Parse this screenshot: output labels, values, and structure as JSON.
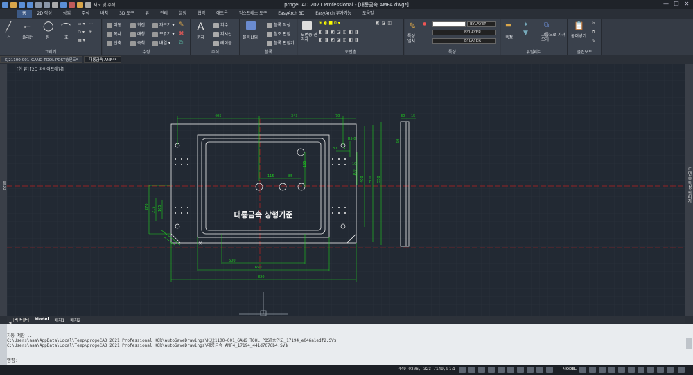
{
  "window": {
    "title": "progeCAD 2021 Professional - [대룡금속 AMF4.dwg*]",
    "quick_access_label": "재도 및 주석"
  },
  "ribbon_tabs": [
    "홈",
    "2D 작성",
    "상입",
    "주석",
    "배치",
    "3D 도구",
    "뷰",
    "관리",
    "설정",
    "협력",
    "애드온",
    "익스프레스 도구",
    "EasyArch 3D",
    "EasyArch 부가기능",
    "도움말"
  ],
  "ribbon_active_tab": "홈",
  "ribbon": {
    "draw": {
      "label": "그리기",
      "line": "선",
      "polyline": "폴리선",
      "circle": "원",
      "arc": "호"
    },
    "modify": {
      "label": "수정",
      "move": "이동",
      "rotate": "회전",
      "trim": "자르기",
      "copy": "복사",
      "mirror": "대칭",
      "fillet": "모깎기",
      "stretch": "신축",
      "scale": "축척",
      "array": "배열"
    },
    "annotation": {
      "label": "주석",
      "text": "문자",
      "dimension": "치수",
      "leader": "지시선",
      "table": "테이블"
    },
    "block": {
      "label": "블록",
      "insert": "블록삽입",
      "create": "블록 작성",
      "edit_ref": "참조 편집",
      "block_editor": "블록 편집기"
    },
    "layers": {
      "label": "도면층",
      "layer_props": "도면층 관리자"
    },
    "properties": {
      "label": "특성",
      "match": "특성 일치",
      "bylayer1": "BYLAYER",
      "bylayer2": "BYLAYER",
      "bylayer3": "BYLAYER"
    },
    "utilities": {
      "label": "유틸리티",
      "measure": "측정",
      "group": "그룹",
      "select": "그룹으로 가져오기"
    },
    "clipboard": {
      "label": "클립보드",
      "paste": "붙여넣기"
    }
  },
  "doc_tabs": [
    {
      "label": "KJ21100-001_GANG TOOL POST승인도*",
      "active": false
    },
    {
      "label": "대룡금속 AMF4*",
      "active": true
    }
  ],
  "viewport_label": "[현 뷰] [2D 와이어프레임]",
  "left_panel_label": "특성",
  "right_panel_label": "도면층 특성 관리자",
  "drawing": {
    "center_text": "대룡금속 상형기준",
    "dims": {
      "top1": "405",
      "top2": "343",
      "top3": "70",
      "side_top1": "30",
      "side_top2": "15",
      "d115": "115",
      "d85": "85",
      "d165": "165",
      "d30": "30",
      "d15": "15",
      "d10": "10",
      "d60": "60",
      "dR": "R5.0",
      "v100": "100",
      "v400": "400",
      "v500": "500",
      "v550": "550",
      "v270": "270",
      "v215": "215",
      "v165b": "165",
      "b600": "600",
      "b650": "650",
      "b820": "820"
    }
  },
  "layout_tabs": [
    "Model",
    "배치1",
    "배치2"
  ],
  "layout_active": "Model",
  "command_lines": [
    "자동 저장...",
    "C:\\Users\\aaa\\AppData\\Local\\Temp\\progeCAD 2021 Professional KOR\\AutoSaveDrawings\\KJ21100-001_GANG TOOL POST승인도_17194_e046a1edf2.SV$",
    "C:\\Users\\aaa\\AppData\\Local\\Temp\\progeCAD 2021 Professional KOR\\AutoSaveDrawings\\대룡금속 AMF4_17194_441d7076b4.SV$"
  ],
  "command_prompt": "명령:",
  "status": {
    "coords": "449.0306,-323.7149,0",
    "scale": "1:1",
    "model": "MODEL"
  },
  "colors": {
    "canvas": "#222933",
    "green": "#1fd01f",
    "white": "#f2f2f2",
    "red": "#d22a2a",
    "accent": "#3d5a86"
  }
}
